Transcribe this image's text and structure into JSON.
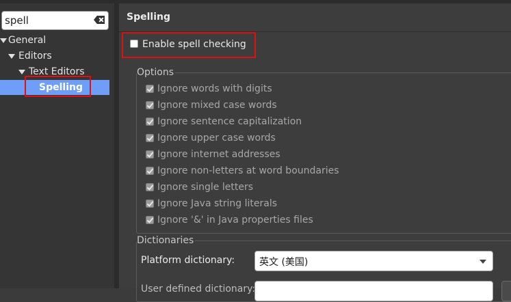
{
  "filter": {
    "value": "spell"
  },
  "tree": {
    "general": "General",
    "editors": "Editors",
    "text_editors": "Text Editors",
    "spelling": "Spelling"
  },
  "page": {
    "title": "Spelling",
    "enable_label": "Enable spell checking",
    "enable_checked": false
  },
  "options": {
    "title": "Options",
    "items": [
      "Ignore words with digits",
      "Ignore mixed case words",
      "Ignore sentence capitalization",
      "Ignore upper case words",
      "Ignore internet addresses",
      "Ignore non-letters at word boundaries",
      "Ignore single letters",
      "Ignore Java string literals",
      "Ignore '&' in Java properties files"
    ]
  },
  "dictionaries": {
    "title": "Dictionaries",
    "platform_label": "Platform dictionary:",
    "platform_value": "英文 (美国)",
    "user_label": "User defined dictionary:"
  },
  "colors": {
    "selection": "#6f9ef8",
    "highlight": "#e01010"
  }
}
